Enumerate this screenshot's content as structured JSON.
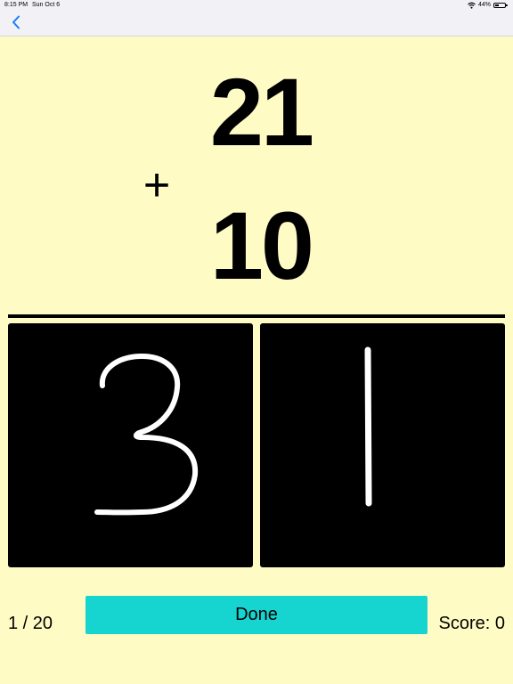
{
  "status_bar": {
    "time": "8:15 PM",
    "date": "Sun Oct 6",
    "battery": "44%",
    "battery_level": 0.44
  },
  "nav": {
    "back_icon": "chevron-left-icon",
    "accent_color": "#147efb"
  },
  "problem": {
    "top_operand": "21",
    "operator": "+",
    "bottom_operand": "10"
  },
  "answer_pads": [
    {
      "place": "tens",
      "drawn_digit": "3"
    },
    {
      "place": "ones",
      "drawn_digit": "1"
    }
  ],
  "footer": {
    "progress": "1 / 20",
    "done_label": "Done",
    "score": "Score: 0"
  },
  "colors": {
    "background": "#fffbc4",
    "pad_background": "#000000",
    "ink": "#ffffff",
    "done_button": "#16d4d0"
  }
}
